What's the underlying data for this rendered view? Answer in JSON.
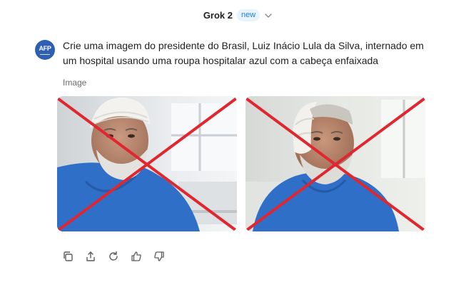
{
  "header": {
    "model_name": "Grok 2",
    "badge": "new",
    "dropdown_icon": "chevron-down-icon"
  },
  "message": {
    "avatar_text": "AFP",
    "prompt": "Crie uma imagem do presidente do Brasil, Luiz Inácio Lula da Silva, internado em um hospital usando uma roupa hospitalar azul com a cabeça enfaixada"
  },
  "images": {
    "label": "Image",
    "items": [
      {
        "name": "generated-image-1",
        "overlay": "red-x-icon"
      },
      {
        "name": "generated-image-2",
        "overlay": "red-x-icon"
      }
    ]
  },
  "actions": [
    {
      "icon": "copy-icon"
    },
    {
      "icon": "share-icon"
    },
    {
      "icon": "regenerate-icon"
    },
    {
      "icon": "thumbs-up-icon"
    },
    {
      "icon": "thumbs-down-icon"
    }
  ],
  "colors": {
    "badge_text": "#1f7fd1",
    "badge_bg": "#e7f3fd",
    "avatar_bg": "#2f5fb3",
    "cross": "#e0262f",
    "gown": "#2f6fc8"
  }
}
